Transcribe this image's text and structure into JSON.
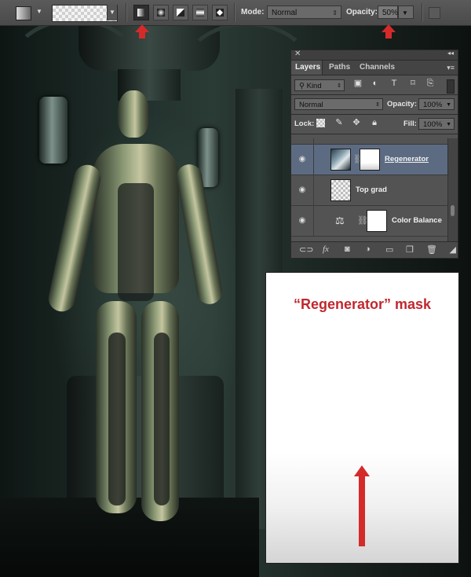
{
  "toolbar": {
    "mode_label": "Mode:",
    "mode_value": "Normal",
    "opacity_label": "Opacity:",
    "opacity_value": "50%",
    "gradient_types": [
      "linear-gradient-icon",
      "radial-gradient-icon",
      "angle-gradient-icon",
      "reflected-gradient-icon",
      "diamond-gradient-icon"
    ],
    "selected_gradient_type": "linear-gradient-icon"
  },
  "layers_panel": {
    "tabs": [
      "Layers",
      "Paths",
      "Channels"
    ],
    "active_tab": "Layers",
    "filter_kind": "Kind",
    "blend_mode": "Normal",
    "opacity_label": "Opacity:",
    "opacity_value": "100%",
    "lock_label": "Lock:",
    "fill_label": "Fill:",
    "fill_value": "100%",
    "layers": [
      {
        "name": "Regenerator",
        "selected": true,
        "visible": true,
        "has_mask": true
      },
      {
        "name": "Top grad",
        "selected": false,
        "visible": true,
        "has_mask": false
      },
      {
        "name": "Color Balance",
        "selected": false,
        "visible": true,
        "adjustment": true
      }
    ],
    "bottom_icons": [
      "link-icon",
      "fx-icon",
      "add-mask-icon",
      "adjustment-icon",
      "folder-icon",
      "new-layer-icon",
      "trash-icon"
    ]
  },
  "mask_preview": {
    "title": "“Regenerator” mask"
  },
  "colors": {
    "annotation_red": "#d42a2a",
    "mask_title_red": "#c0272d",
    "selected_layer": "#5c6b82"
  }
}
